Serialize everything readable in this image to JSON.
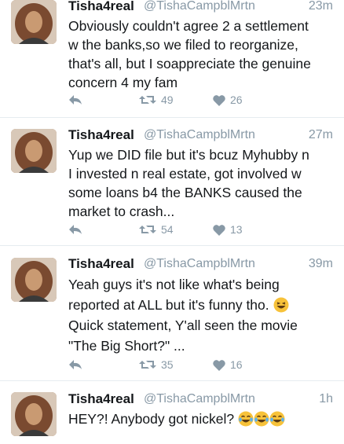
{
  "tweets": [
    {
      "name": "Tisha4real",
      "handle": "@TishaCampblMrtn",
      "time": "23m",
      "lines": [
        "Obviously couldn't agree 2 a settlement",
        "w the banks,so we filed to reorganize,",
        "that's all, but I soappreciate the genuine",
        "concern 4 my fam"
      ],
      "retweets": "49",
      "likes": "26"
    },
    {
      "name": "Tisha4real",
      "handle": "@TishaCampblMrtn",
      "time": "27m",
      "lines": [
        "Yup we DID file but  it's bcuz Myhubby n",
        "I invested n real estate, got involved w",
        "some loans b4 the BANKS caused the",
        "market to crash..."
      ],
      "retweets": "54",
      "likes": "13"
    },
    {
      "name": "Tisha4real",
      "handle": "@TishaCampblMrtn",
      "time": "39m",
      "lines": [
        "Yeah guys it's not like what's being",
        "reported at ALL but it's funny tho.",
        "Quick statement, Y'all seen the movie",
        "\"The Big Short?\" ..."
      ],
      "retweets": "35",
      "likes": "16"
    },
    {
      "name": "Tisha4real",
      "handle": "@TishaCampblMrtn",
      "time": "1h",
      "lines": [
        "HEY?! Anybody got nickel?"
      ]
    }
  ],
  "icons": {
    "reply": "reply-icon",
    "retweet": "retweet-icon",
    "like": "heart-icon",
    "laugh": "laughing-emoji-icon",
    "tears": "tears-of-joy-emoji-icon"
  },
  "colors": {
    "text": "#14171a",
    "muted": "#8899a6",
    "divider": "#e6ecf0"
  }
}
